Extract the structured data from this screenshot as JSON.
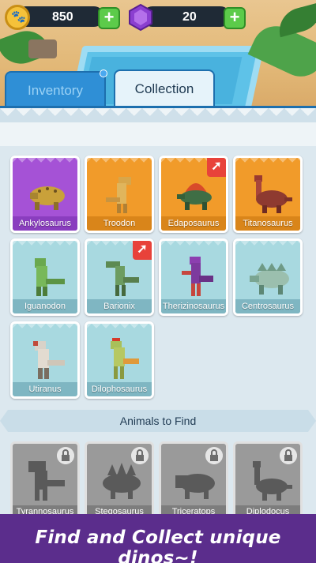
{
  "currency": {
    "coins": "850",
    "gems": "20",
    "coin_icon": "paw-coin-icon",
    "gem_icon": "purple-gem-icon",
    "plus_icon": "plus-icon"
  },
  "tabs": [
    {
      "label": "Inventory",
      "active": false
    },
    {
      "label": "Collection",
      "active": true
    }
  ],
  "collection": {
    "cards": [
      {
        "name": "Ankylosaurus",
        "rarity": "purple",
        "badge": false
      },
      {
        "name": "Troodon",
        "rarity": "orange",
        "badge": false
      },
      {
        "name": "Edaposaurus",
        "rarity": "orange",
        "badge": true
      },
      {
        "name": "Titanosaurus",
        "rarity": "orange",
        "badge": false
      },
      {
        "name": "Iguanodon",
        "rarity": "teal",
        "badge": false
      },
      {
        "name": "Barionix",
        "rarity": "teal",
        "badge": true
      },
      {
        "name": "Therizinosaurus",
        "rarity": "teal",
        "badge": false
      },
      {
        "name": "Centrosaurus",
        "rarity": "teal",
        "badge": false
      },
      {
        "name": "Utiranus",
        "rarity": "teal",
        "badge": false
      },
      {
        "name": "Dilophosaurus",
        "rarity": "teal",
        "badge": false
      }
    ]
  },
  "to_find": {
    "title": "Animals to Find",
    "locked": [
      {
        "name": "Tyrannosaurus"
      },
      {
        "name": "Stegosaurus"
      },
      {
        "name": "Triceratops"
      },
      {
        "name": "Diplodocus"
      }
    ]
  },
  "banner": {
    "text": "Find and Collect unique dinos~!"
  },
  "colors": {
    "purple_rarity": "#a552d6",
    "orange_rarity": "#f19b2a",
    "teal_rarity": "#a8d9e0",
    "banner_bg": "#5b2d8c",
    "tab_blue": "#2f8fd6"
  }
}
